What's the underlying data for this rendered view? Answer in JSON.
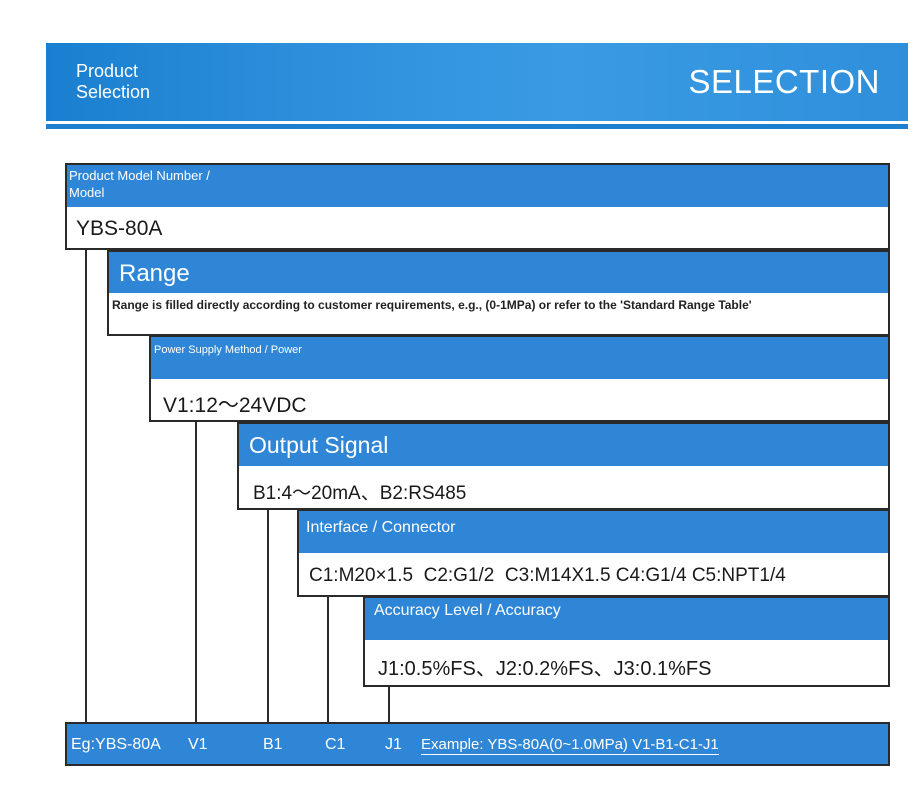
{
  "banner": {
    "left_text_line1": "Product",
    "left_text_line2": "Selection",
    "right_text": "SELECTION"
  },
  "blocks": {
    "model": {
      "head_line1": "Product Model Number /",
      "head_line2": "Model",
      "body": "YBS-80A"
    },
    "range": {
      "head": "Range",
      "body": "Range is filled directly according to customer requirements, e.g., (0-1MPa) or refer to the 'Standard Range Table'"
    },
    "power": {
      "head": "Power Supply Method / Power",
      "body": "V1:12～24VDC"
    },
    "output": {
      "head": "Output Signal",
      "body": "B1:4～20mA、B2:RS485"
    },
    "interface": {
      "head": "Interface / Connector",
      "body": "C1:M20×1.5  C2:G1/2  C3:M14X1.5 C4:G1/4 C5:NPT1/4"
    },
    "accuracy": {
      "head": "Accuracy Level / Accuracy",
      "body": "J1:0.5%FS、J2:0.2%FS、J3:0.1%FS"
    }
  },
  "footer": {
    "model": "Eg:YBS-80A",
    "v": "V1",
    "b": "B1",
    "c": "C1",
    "j": "J1",
    "example": "Example: YBS-80A(0~1.0MPa) V1-B1-C1-J1"
  },
  "colors": {
    "accent": "#2f86d6",
    "banner": "#2d8fdc",
    "line": "#2a2a2a"
  }
}
